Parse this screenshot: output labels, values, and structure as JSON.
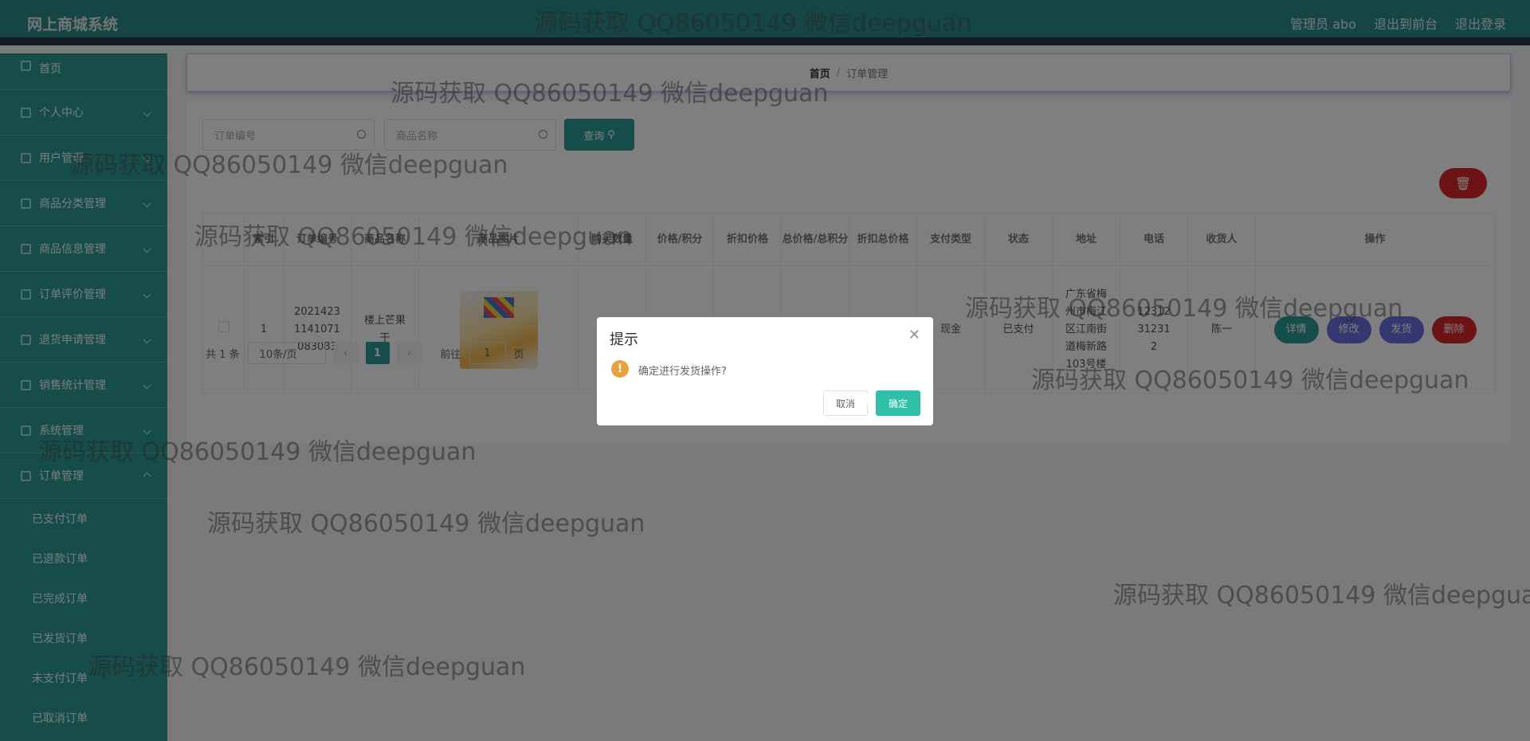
{
  "header": {
    "brand": "网上商城系统",
    "nav": [
      "管理员 abo",
      "退出到前台",
      "退出登录"
    ]
  },
  "sidebar": {
    "items": [
      {
        "label": "首页",
        "icon": "home-icon"
      },
      {
        "label": "个人中心",
        "icon": "user-icon"
      },
      {
        "label": "用户管理",
        "icon": "mail-icon"
      },
      {
        "label": "商品分类管理",
        "icon": "user-icon"
      },
      {
        "label": "商品信息管理",
        "icon": "building-icon"
      },
      {
        "label": "订单评价管理",
        "icon": "monitor-icon"
      },
      {
        "label": "退货申请管理",
        "icon": "location-icon"
      },
      {
        "label": "销售统计管理",
        "icon": "building-icon"
      },
      {
        "label": "系统管理",
        "icon": "globe-icon"
      },
      {
        "label": "订单管理",
        "icon": "send-icon"
      }
    ],
    "sub_items": [
      "已支付订单",
      "已退款订单",
      "已完成订单",
      "已发货订单",
      "未支付订单",
      "已取消订单"
    ]
  },
  "breadcrumb": {
    "home": "首页",
    "sep": "/",
    "current": "订单管理"
  },
  "search": {
    "order_no_placeholder": "订单编号",
    "product_name_placeholder": "商品名称",
    "query_label": "查询"
  },
  "table": {
    "headers": [
      "",
      "索引",
      "订单编号",
      "商品名称",
      "商品图片",
      "购买数量",
      "价格/积分",
      "折扣价格",
      "总价格/总积分",
      "折扣总价格",
      "支付类型",
      "状态",
      "地址",
      "电话",
      "收货人",
      "操作"
    ],
    "row": {
      "index": "1",
      "order_no": "20214231141071083083",
      "product_name": "楼上芒果干",
      "quantity": "",
      "price": "",
      "discount_price": "",
      "total": "",
      "discount_total": "",
      "pay_type": "现金",
      "status": "已支付",
      "address": "广东省梅州市梅江区江南街道梅新路103号楼",
      "phone": "12312312312",
      "receiver": "陈一"
    },
    "actions": [
      "详情",
      "修改",
      "发货",
      "删除"
    ]
  },
  "pager": {
    "total": "共 1 条",
    "page_size": "10条/页",
    "current_page": "1",
    "goto_label": "前往",
    "goto_value": "1",
    "page_unit": "页"
  },
  "dialog": {
    "title": "提示",
    "message": "确定进行发货操作?",
    "cancel": "取消",
    "confirm": "确定"
  },
  "watermark": "源码获取 QQ86050149 微信deepguan",
  "colors": {
    "primary": "#2b9a96",
    "danger": "#d7262a",
    "accent": "#6a6fe0",
    "confirm": "#2fc0a8"
  }
}
